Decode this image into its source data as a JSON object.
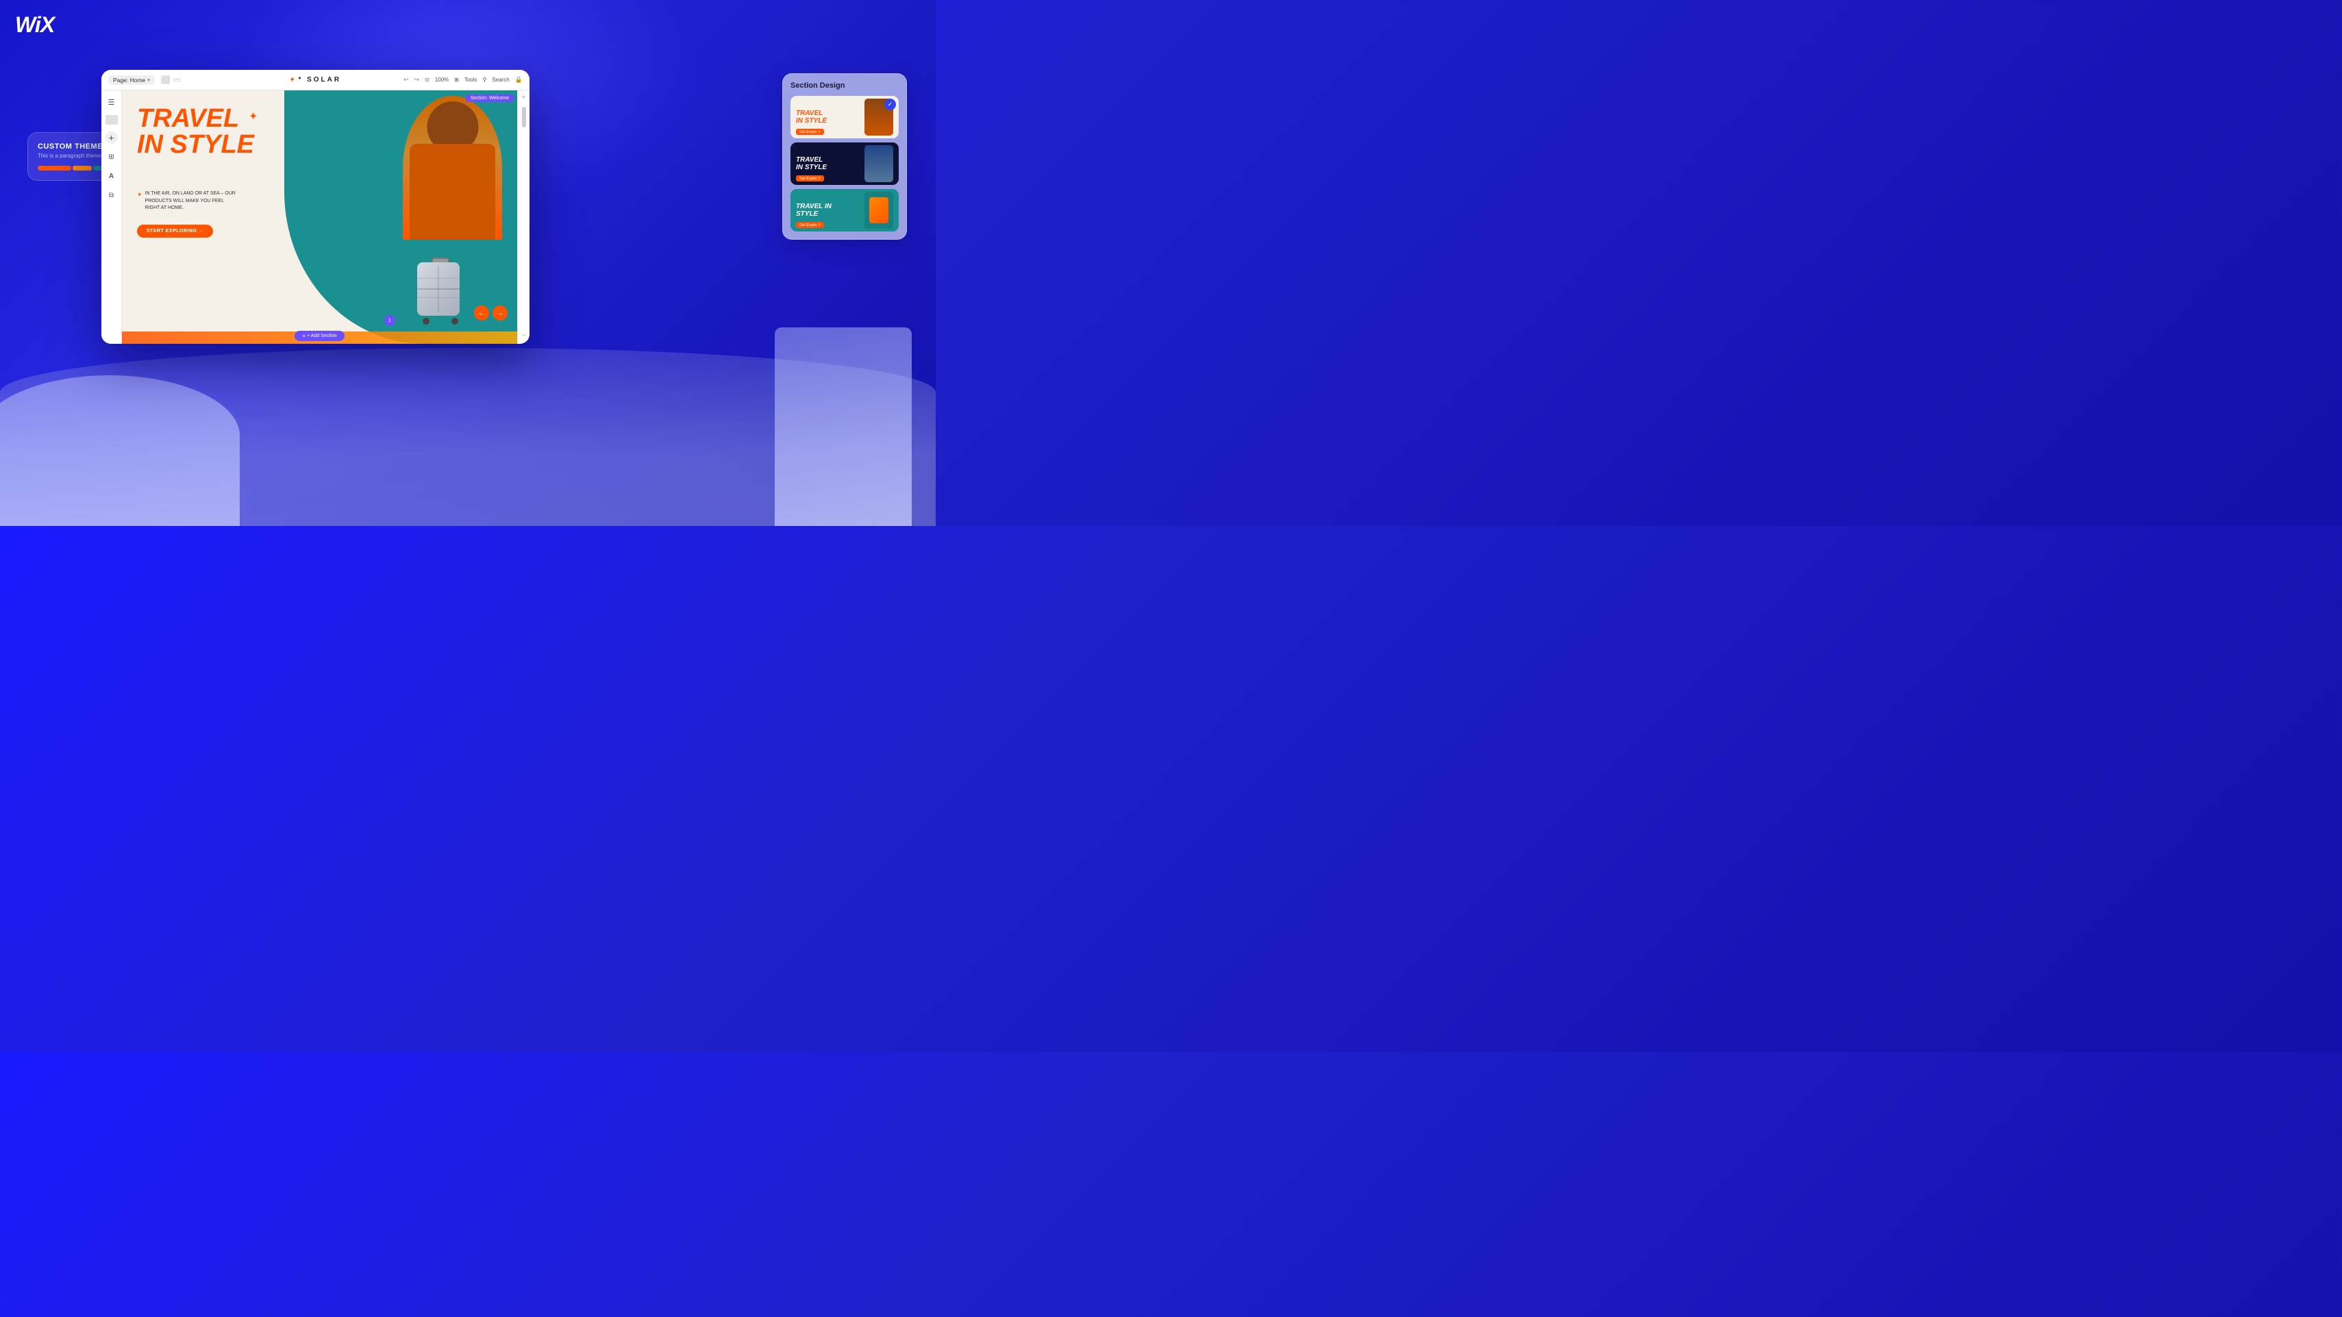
{
  "app": {
    "logo": "WiX",
    "brand_color": "#1a1aff"
  },
  "editor": {
    "topbar": {
      "page_selector_label": "Page: Home",
      "zoom_level": "100%",
      "tools_label": "Tools",
      "search_label": "Search"
    },
    "brand_name": "* SOLAR",
    "section_badge": "Section: Welcome",
    "hero": {
      "title_line1": "TRAVEL",
      "title_line2": "IN STYLE",
      "subtitle": "IN THE AIR, ON LAND OR AT SEA – OUR PRODUCTS WILL MAKE YOU FEEL RIGHT AT HOME.",
      "cta_label": "START EXPLORING →",
      "add_section_label": "+ Add Section"
    }
  },
  "section_design_panel": {
    "title": "Section Design",
    "cards": [
      {
        "id": "card-1",
        "title_line1": "TRAVEL",
        "title_line2": "IN STYLE",
        "badge": "Get Explor 1",
        "selected": true,
        "bg": "light"
      },
      {
        "id": "card-2",
        "title_line1": "TRAVEL",
        "title_line2": "IN STYLE",
        "badge": "Get Explor 2",
        "selected": false,
        "bg": "dark"
      },
      {
        "id": "card-3",
        "title_line1": "TRAVEL IN",
        "title_line2": "STYLE",
        "badge": "Get Explor 3",
        "selected": false,
        "bg": "teal"
      }
    ]
  },
  "custom_theme_panel": {
    "title": "CUSTOM THEME",
    "subtitle": "This is a paragraph theme",
    "colors": [
      {
        "hex": "#ff5500",
        "width": 35
      },
      {
        "hex": "#ff8800",
        "width": 20
      },
      {
        "hex": "#1a9090",
        "width": 20
      },
      {
        "hex": "#9B8AFF",
        "width": 15
      },
      {
        "hex": "#ffffff",
        "width": 10
      }
    ]
  },
  "icons": {
    "undo": "↩",
    "redo": "↪",
    "desktop": "🖥",
    "mobile": "📱",
    "tools": "🔧",
    "search": "🔍",
    "layers": "☰",
    "add": "+",
    "apps": "⊞",
    "paint": "A",
    "lock": "🔒",
    "zoom_in": "+",
    "zoom_out": "−",
    "chevron_down": "▾",
    "arrow_left": "←",
    "arrow_right": "→",
    "sparkle": "✦",
    "star": "✦",
    "check": "✓"
  }
}
